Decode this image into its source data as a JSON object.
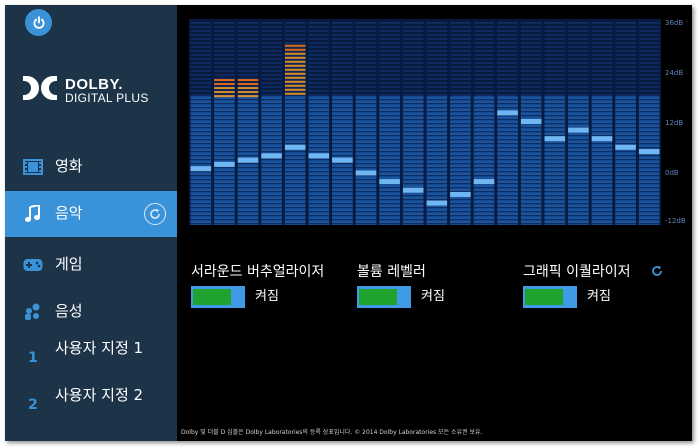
{
  "sidebar": {
    "brand": "DOLBY.",
    "product": "DIGITAL PLUS",
    "items": [
      {
        "label": "영화",
        "icon": "film-icon"
      },
      {
        "label": "음악",
        "icon": "music-note-icon",
        "active": true
      },
      {
        "label": "게임",
        "icon": "gamepad-icon"
      },
      {
        "label": "음성",
        "icon": "voice-icon"
      },
      {
        "label": "사용자 지정 1",
        "icon": "custom-1-icon",
        "number": "1"
      },
      {
        "label": "사용자 지정 2",
        "icon": "custom-2-icon",
        "number": "2"
      }
    ]
  },
  "equalizer": {
    "db_labels": [
      "36dB",
      "24dB",
      "12dB",
      "0dB",
      "-12dB"
    ],
    "bands_db": [
      1,
      2,
      3,
      4,
      6,
      4,
      3,
      0,
      -2,
      -4,
      -7,
      -5,
      -2,
      14,
      12,
      8,
      10,
      8,
      6,
      5
    ],
    "peaks_db": [
      18,
      22,
      22,
      null,
      30,
      null,
      null,
      null,
      null,
      null,
      null,
      null,
      null,
      null,
      null,
      null,
      null,
      null,
      null,
      null
    ],
    "colors": {
      "bar": "#2b73c1",
      "bar_fill": "#1a54a0",
      "indicator": "#6fb6f2",
      "peak": "#d98d2b",
      "peak_top": "#e26a1c",
      "grid": "#071a3f",
      "accent": "#3a93d8"
    }
  },
  "controls": [
    {
      "title": "서라운드 버추얼라이저",
      "state": "켜짐",
      "on": true
    },
    {
      "title": "볼륨 레벨러",
      "state": "켜짐",
      "on": true
    },
    {
      "title": "그래픽 이퀄라이저",
      "state": "켜짐",
      "on": true
    }
  ],
  "footer": "Dolby 및 더블 D 심볼은 Dolby Laboratories의 등록 상표입니다. © 2014 Dolby Laboratories 모든 소유권 보유."
}
